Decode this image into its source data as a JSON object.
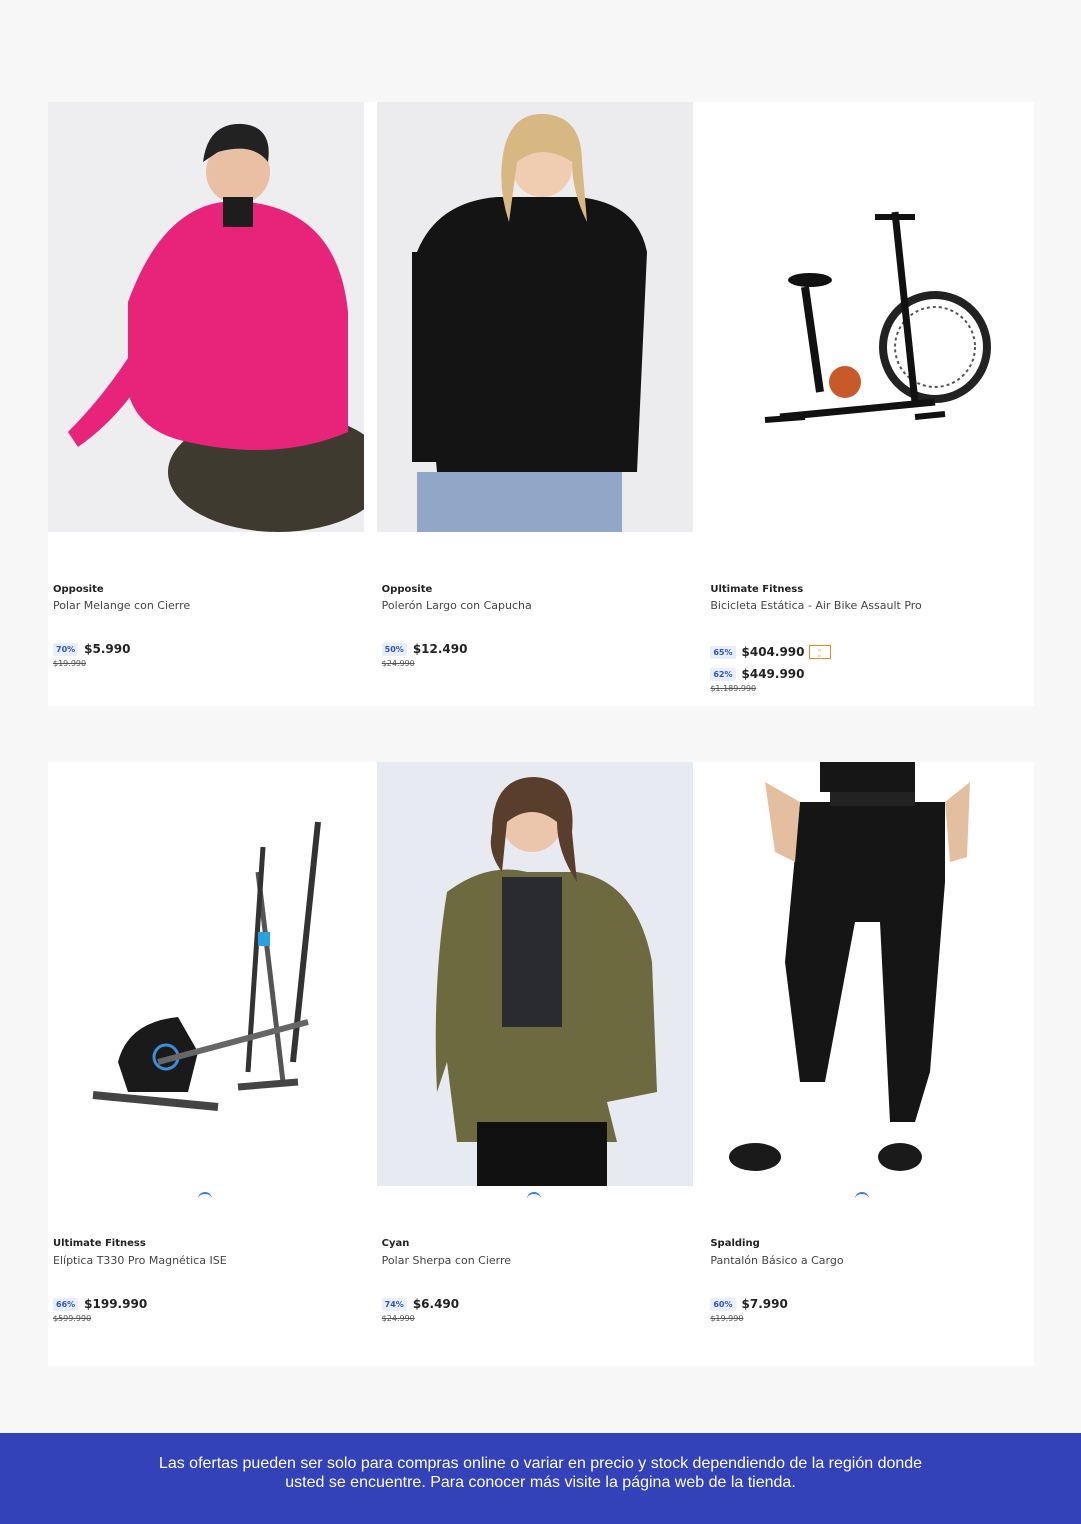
{
  "products": [
    {
      "brand": "Opposite",
      "name": "Polar Melange con Cierre",
      "discount": "70%",
      "price": "$5.990",
      "old_price": "$19.990",
      "image": "woman-pink-fleece"
    },
    {
      "brand": "Opposite",
      "name": "Polerón Largo con Capucha",
      "discount": "50%",
      "price": "$12.490",
      "old_price": "$24.990",
      "image": "woman-black-hoodie"
    },
    {
      "brand": "Ultimate Fitness",
      "name": "Bicicleta Estática - Air Bike Assault Pro",
      "discount": "65%",
      "price": "$404.990",
      "discount2": "62%",
      "price2": "$449.990",
      "old_price": "$1.189.990",
      "image": "air-bike",
      "tag_icon": "discount-card-icon"
    },
    {
      "brand": "Ultimate Fitness",
      "name": "Elíptica T330 Pro Magnética ISE",
      "discount": "66%",
      "price": "$199.990",
      "old_price": "$599.990",
      "image": "elliptical-trainer"
    },
    {
      "brand": "Cyan",
      "name": "Polar Sherpa con Cierre",
      "discount": "74%",
      "price": "$6.490",
      "old_price": "$24.990",
      "image": "woman-olive-sherpa"
    },
    {
      "brand": "Spalding",
      "name": "Pantalón Básico a Cargo",
      "discount": "60%",
      "price": "$7.990",
      "old_price": "$19.990",
      "image": "black-cargo-joggers"
    }
  ],
  "footer": {
    "line1": "Las ofertas pueden ser solo para compras online o variar en precio y stock dependiendo de la región donde",
    "line2": "usted se encuentre. Para conocer más visite la página web de la tienda."
  },
  "colors": {
    "accent": "#3342b8",
    "badge_text": "#2d55c8",
    "badge_bg": "#e8eefc"
  }
}
